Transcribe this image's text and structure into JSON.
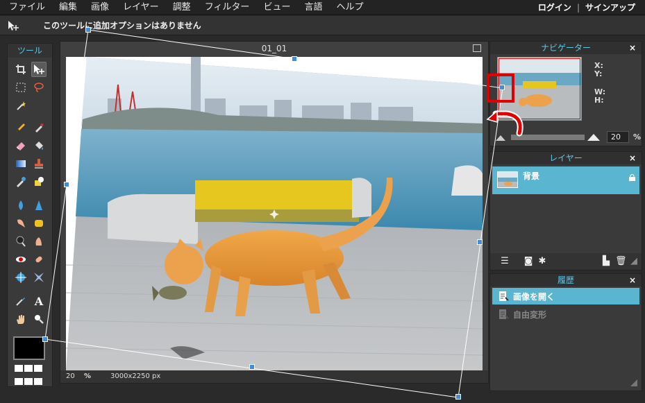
{
  "menubar": {
    "items": [
      "ファイル",
      "編集",
      "画像",
      "レイヤー",
      "調整",
      "フィルター",
      "ビュー",
      "言語",
      "ヘルプ"
    ],
    "login": "ログイン",
    "separator": "|",
    "signup": "サインアップ"
  },
  "options_bar": {
    "message": "このツールに追加オプションはありません"
  },
  "tools": {
    "title": "ツール"
  },
  "document": {
    "title": "01_01",
    "zoom": "20",
    "zoom_unit": "%",
    "size": "3000x2250 px"
  },
  "navigator": {
    "title": "ナビゲーター",
    "close": "×",
    "x_label": "X:",
    "y_label": "Y:",
    "w_label": "W:",
    "h_label": "H:",
    "zoom": "20",
    "zoom_unit": "%"
  },
  "layers": {
    "title": "レイヤー",
    "close": "×",
    "items": [
      {
        "name": "背景"
      }
    ]
  },
  "history": {
    "title": "履歴",
    "close": "×",
    "items": [
      {
        "label": "画像を開く",
        "active": true
      },
      {
        "label": "自由変形",
        "active": false
      }
    ]
  },
  "colors": {
    "accent": "#5ab6d0",
    "title_text": "#5ec8e8",
    "handle": "#3d8ee0",
    "annotation_red": "#e00000"
  }
}
